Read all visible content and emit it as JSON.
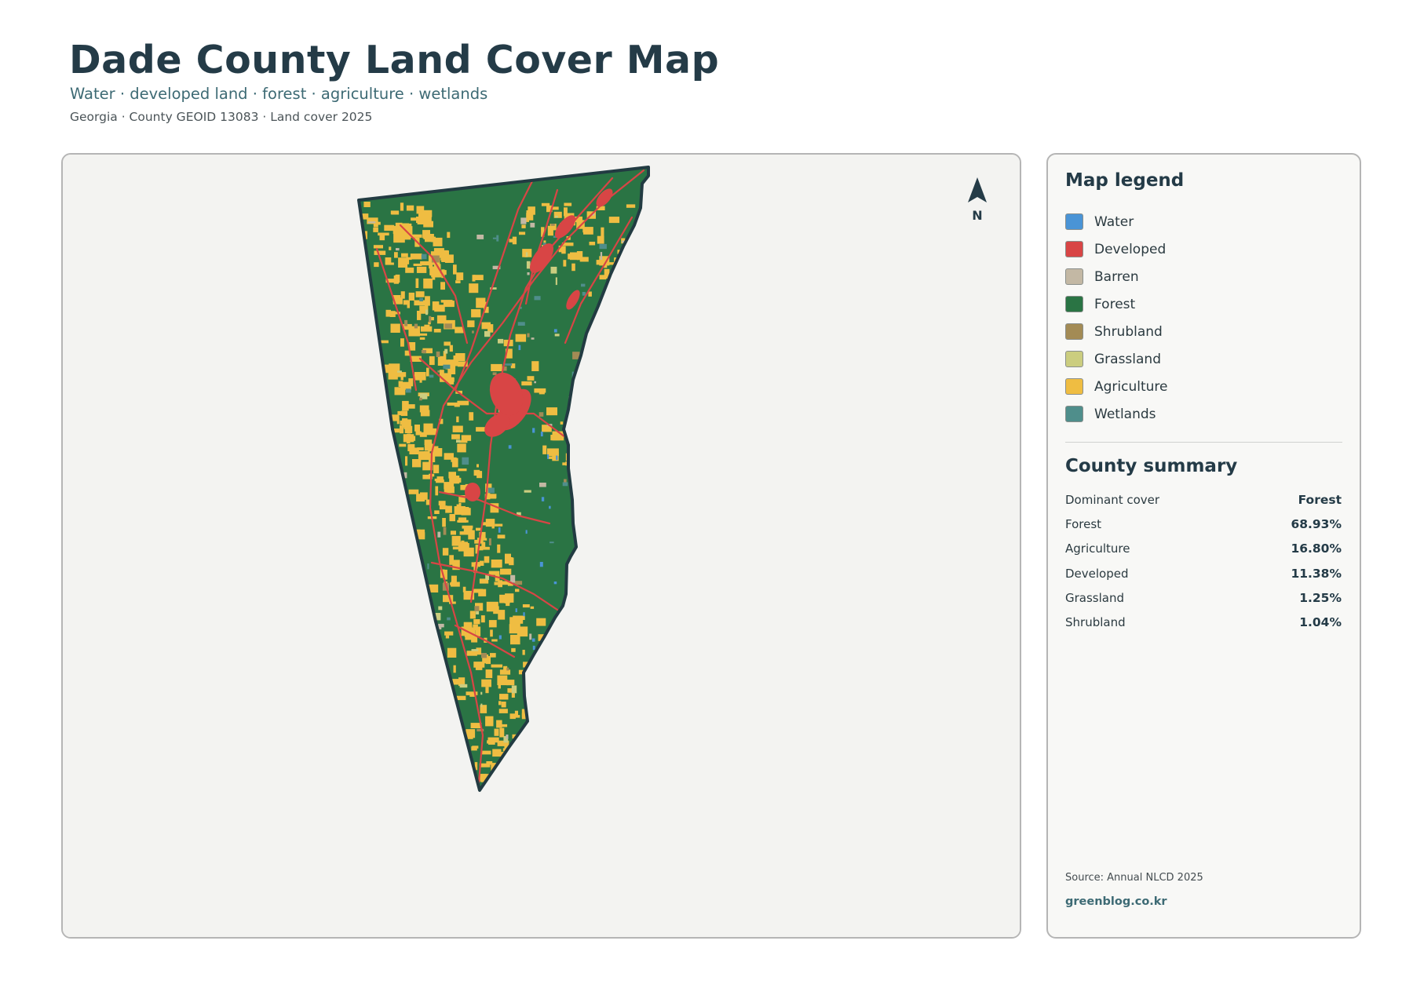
{
  "header": {
    "title": "Dade County Land Cover Map",
    "subtitle": "Water · developed land · forest · agriculture · wetlands",
    "meta": "Georgia · County GEOID 13083 · Land cover 2025"
  },
  "map": {
    "north_label": "N",
    "colors": {
      "background": "#f3f3f1",
      "outline": "#223b42",
      "forest": "#2a7444",
      "developed": "#d84545",
      "agriculture": "#efbd42",
      "water": "#4a94d6",
      "grassland": "#cbcd7f",
      "shrubland": "#a38b55",
      "barren": "#c3b8a4",
      "wetlands": "#4f8e8b"
    }
  },
  "legend": {
    "title": "Map legend",
    "items": [
      {
        "label": "Water",
        "color": "#4a94d6"
      },
      {
        "label": "Developed",
        "color": "#d84545"
      },
      {
        "label": "Barren",
        "color": "#c3b8a4"
      },
      {
        "label": "Forest",
        "color": "#2a7444"
      },
      {
        "label": "Shrubland",
        "color": "#a38b55"
      },
      {
        "label": "Grassland",
        "color": "#cbcd7f"
      },
      {
        "label": "Agriculture",
        "color": "#efbd42"
      },
      {
        "label": "Wetlands",
        "color": "#4f8e8b"
      }
    ]
  },
  "summary": {
    "title": "County summary",
    "rows": [
      {
        "label": "Dominant cover",
        "value": "Forest"
      },
      {
        "label": "Forest",
        "value": "68.93%"
      },
      {
        "label": "Agriculture",
        "value": "16.80%"
      },
      {
        "label": "Developed",
        "value": "11.38%"
      },
      {
        "label": "Grassland",
        "value": "1.25%"
      },
      {
        "label": "Shrubland",
        "value": "1.04%"
      }
    ]
  },
  "footer": {
    "source": "Source: Annual NLCD 2025",
    "site": "greenblog.co.kr"
  }
}
